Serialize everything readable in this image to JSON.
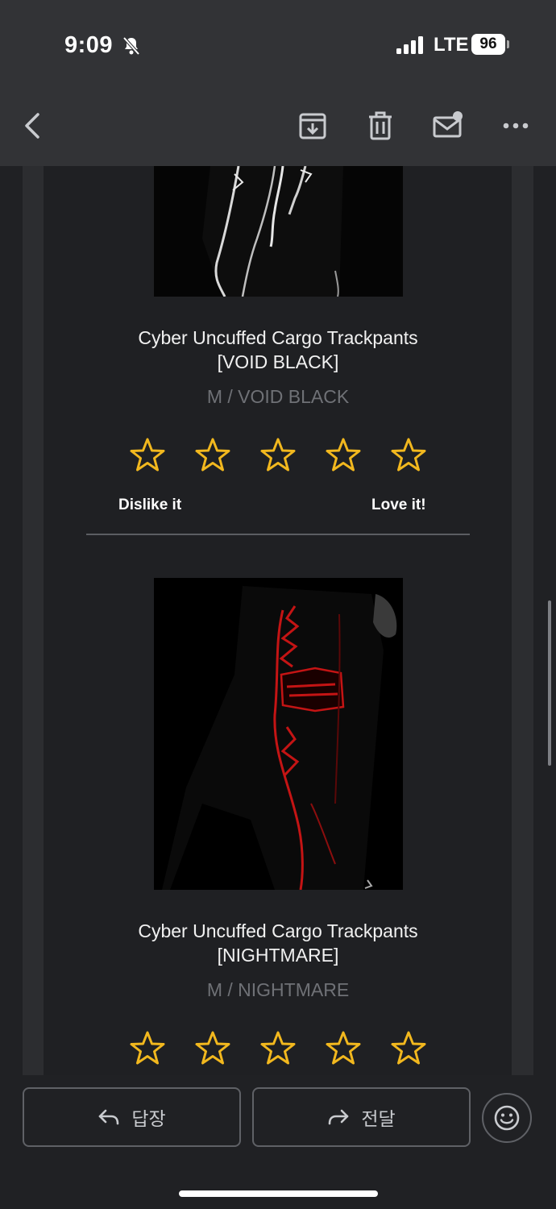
{
  "status_bar": {
    "time": "9:09",
    "network": "LTE",
    "battery": "96"
  },
  "toolbar": {
    "icons": [
      "back-icon",
      "archive-icon",
      "delete-icon",
      "mark-unread-icon",
      "more-icon"
    ]
  },
  "products": [
    {
      "title_line1": "Cyber Uncuffed Cargo Trackpants",
      "title_line2": "[VOID BLACK]",
      "variant": "M / VOID BLACK",
      "rating_stars": 5
    },
    {
      "title_line1": "Cyber Uncuffed Cargo Trackpants",
      "title_line2": "[NIGHTMARE]",
      "variant": "M / NIGHTMARE",
      "rating_stars": 5
    }
  ],
  "rating": {
    "low_label": "Dislike it",
    "high_label": "Love it!"
  },
  "actions": {
    "reply_label": "답장",
    "forward_label": "전달"
  },
  "colors": {
    "star": "#f2b81e",
    "accent_red": "#c41414",
    "background": "#202124"
  }
}
